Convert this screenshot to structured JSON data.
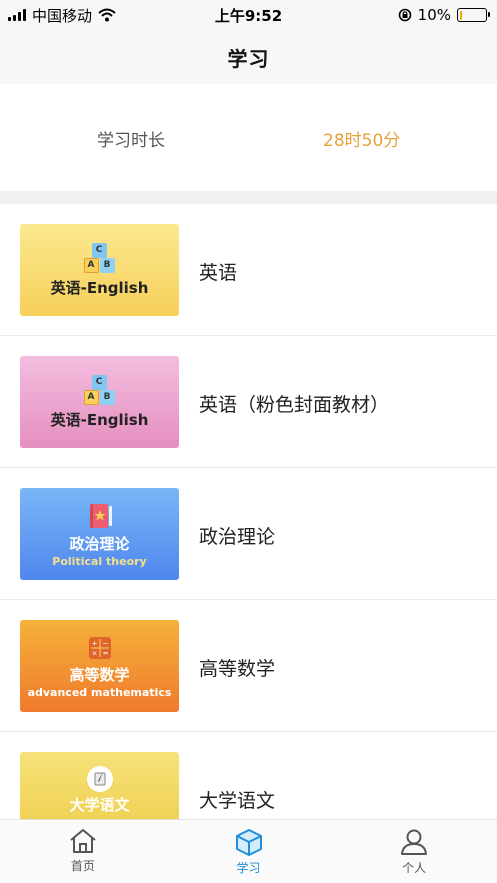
{
  "status_bar": {
    "carrier": "中国移动",
    "time": "上午9:52",
    "battery_text": "10%",
    "battery_level": 0.1,
    "battery_color": "#f2a900"
  },
  "nav": {
    "title": "学习"
  },
  "duration": {
    "label": "学习时长",
    "value": "28时50分",
    "value_color": "#e8a23a"
  },
  "courses": [
    {
      "name": "英语",
      "cover_title": "英语-English",
      "cover_sub": "",
      "cover_icon": "abc-blocks-icon",
      "cover_colors": [
        "#fbe98f",
        "#f6cf5a"
      ]
    },
    {
      "name": "英语（粉色封面教材）",
      "cover_title": "英语-English",
      "cover_sub": "",
      "cover_icon": "abc-blocks-icon",
      "cover_colors": [
        "#f3bedf",
        "#e58fbf"
      ]
    },
    {
      "name": "政治理论",
      "cover_title": "政治理论",
      "cover_sub": "Political theory",
      "cover_icon": "book-icon",
      "cover_colors": [
        "#78b6f6",
        "#4f87ee"
      ]
    },
    {
      "name": "高等数学",
      "cover_title": "高等数学",
      "cover_sub": "advanced mathematics",
      "cover_icon": "calculator-icon",
      "cover_colors": [
        "#f5b13a",
        "#ef7a2c"
      ]
    },
    {
      "name": "大学语文",
      "cover_title": "大学语文",
      "cover_sub": "",
      "cover_icon": "quill-icon",
      "cover_colors": [
        "#f6e27a",
        "#eecc48"
      ]
    }
  ],
  "tabs": [
    {
      "label": "首页",
      "icon": "home-icon",
      "active": false
    },
    {
      "label": "学习",
      "icon": "study-cube-icon",
      "active": true
    },
    {
      "label": "个人",
      "icon": "person-icon",
      "active": false
    }
  ],
  "colors": {
    "accent": "#1e8fd8"
  }
}
